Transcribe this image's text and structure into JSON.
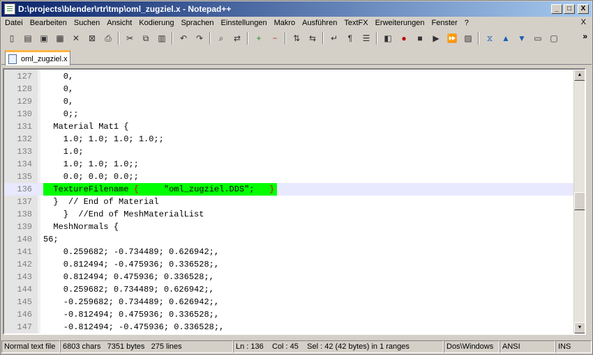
{
  "window": {
    "title": "D:\\projects\\blender\\rtr\\tmp\\oml_zugziel.x - Notepad++"
  },
  "window_controls": {
    "minimize": "_",
    "maximize": "□",
    "close": "X"
  },
  "menu": {
    "items": [
      "Datei",
      "Bearbeiten",
      "Suchen",
      "Ansicht",
      "Kodierung",
      "Sprachen",
      "Einstellungen",
      "Makro",
      "Ausführen",
      "TextFX",
      "Erweiterungen",
      "Fenster",
      "?"
    ],
    "close": "X"
  },
  "toolbar": {
    "icons": [
      "new-file-icon",
      "open-file-icon",
      "save-icon",
      "save-all-icon",
      "close-icon",
      "close-all-icon",
      "print-icon",
      "cut-icon",
      "copy-icon",
      "paste-icon",
      "undo-icon",
      "redo-icon",
      "find-icon",
      "replace-icon",
      "zoom-in-icon",
      "zoom-out-icon",
      "sync-vertical-icon",
      "sync-horizontal-icon",
      "word-wrap-icon",
      "show-all-chars-icon",
      "indent-guide-icon",
      "user-language-icon",
      "record-macro-icon",
      "stop-record-icon",
      "play-macro-icon",
      "play-multiple-icon",
      "save-macro-icon",
      "collapse-icon",
      "up-arrow-icon",
      "down-arrow-icon",
      "monitor-icon",
      "console-icon"
    ],
    "more": "»"
  },
  "tab": {
    "label": "oml_zugziel.x"
  },
  "editor": {
    "lines": [
      {
        "num": "127",
        "text": "    0,"
      },
      {
        "num": "128",
        "text": "    0,"
      },
      {
        "num": "129",
        "text": "    0,"
      },
      {
        "num": "130",
        "text": "    0;;"
      },
      {
        "num": "131",
        "text": "  Material Mat1 {"
      },
      {
        "num": "132",
        "text": "    1.0; 1.0; 1.0; 1.0;;"
      },
      {
        "num": "133",
        "text": "    1.0;"
      },
      {
        "num": "134",
        "text": "    1.0; 1.0; 1.0;;"
      },
      {
        "num": "135",
        "text": "    0.0; 0.0; 0.0;;"
      },
      {
        "num": "136",
        "text": "  TextureFilename {     \"oml_zugziel.DDS\";   }",
        "current": true
      },
      {
        "num": "137",
        "text": "  }  // End of Material"
      },
      {
        "num": "138",
        "text": "    }  //End of MeshMaterialList"
      },
      {
        "num": "139",
        "text": "  MeshNormals {"
      },
      {
        "num": "140",
        "text": "56;"
      },
      {
        "num": "141",
        "text": "    0.259682; -0.734489; 0.626942;,"
      },
      {
        "num": "142",
        "text": "    0.812494; -0.475936; 0.336528;,"
      },
      {
        "num": "143",
        "text": "    0.812494; 0.475936; 0.336528;,"
      },
      {
        "num": "144",
        "text": "    0.259682; 0.734489; 0.626942;,"
      },
      {
        "num": "145",
        "text": "    -0.259682; 0.734489; 0.626942;,"
      },
      {
        "num": "146",
        "text": "    -0.812494; 0.475936; 0.336528;,"
      },
      {
        "num": "147",
        "text": "    -0.812494; -0.475936; 0.336528;,"
      }
    ]
  },
  "status": {
    "file_type": "Normal text file",
    "chars": "6803 chars",
    "bytes": "7351 bytes",
    "lines": "275 lines",
    "ln": "Ln : 136",
    "col": "Col : 45",
    "sel": "Sel : 42 (42 bytes) in 1 ranges",
    "eol": "Dos\\Windows",
    "encoding": "ANSI",
    "mode": "INS"
  }
}
